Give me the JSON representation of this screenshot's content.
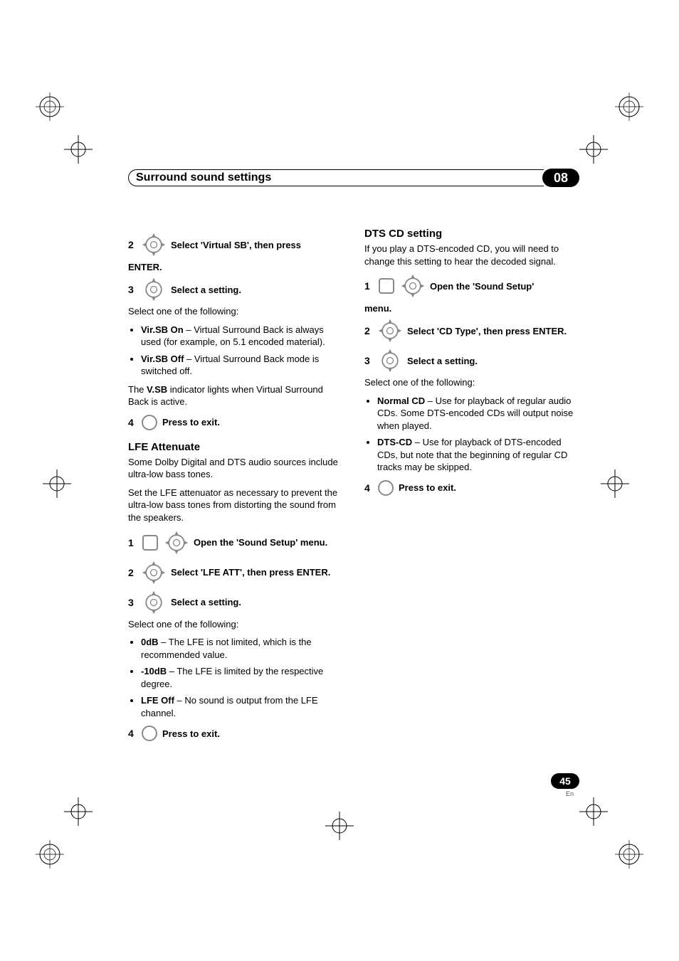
{
  "header": {
    "title": "Surround sound settings",
    "chapter": "08"
  },
  "left": {
    "vsb": {
      "step2": {
        "num": "2",
        "text": "Select 'Virtual SB', then press",
        "tail": "ENTER."
      },
      "step3": {
        "num": "3",
        "text": "Select a setting."
      },
      "select_one": "Select one of the following:",
      "opt1": {
        "k": "Vir.SB On",
        "v": " – Virtual Surround Back is always used (for example, on 5.1 encoded material)."
      },
      "opt2": {
        "k": "Vir.SB Off",
        "v": " – Virtual Surround Back mode is switched off."
      },
      "indicator_a": "The ",
      "indicator_b": "V.SB",
      "indicator_c": " indicator lights when Virtual Surround Back is active.",
      "step4": {
        "num": "4",
        "text": "Press to exit."
      }
    },
    "lfe": {
      "heading": "LFE Attenuate",
      "p1": "Some Dolby Digital and DTS audio sources include ultra-low bass tones.",
      "p2": "Set the LFE attenuator as necessary to prevent the ultra-low bass tones from distorting the sound from the speakers.",
      "step1": {
        "num": "1",
        "text": "Open the 'Sound Setup' menu."
      },
      "step2": {
        "num": "2",
        "text": "Select 'LFE ATT', then press ENTER."
      },
      "step3": {
        "num": "3",
        "text": "Select a setting."
      },
      "select_one": "Select one of the following:",
      "opt1": {
        "k": "0dB",
        "v": " – The LFE is not limited, which is the recommended value."
      },
      "opt2": {
        "k": "-10dB",
        "v": " – The LFE is limited by the respective degree."
      },
      "opt3": {
        "k": "LFE Off",
        "v": " – No sound is output from the LFE channel."
      },
      "step4": {
        "num": "4",
        "text": "Press to exit."
      }
    }
  },
  "right": {
    "dts": {
      "heading": "DTS CD setting",
      "p1": "If you play a DTS-encoded CD, you will need to change this setting to hear the decoded signal.",
      "step1": {
        "num": "1",
        "text": "Open the 'Sound Setup'",
        "tail": "menu."
      },
      "step2": {
        "num": "2",
        "text": "Select 'CD Type', then press ENTER."
      },
      "step3": {
        "num": "3",
        "text": "Select a setting."
      },
      "select_one": "Select one of the following:",
      "opt1": {
        "k": "Normal CD",
        "v": " – Use for playback of regular audio CDs. Some DTS-encoded CDs will output noise when played."
      },
      "opt2": {
        "k": "DTS-CD",
        "v": " – Use for playback of DTS-encoded CDs, but note that the beginning of regular CD tracks may be skipped."
      },
      "step4": {
        "num": "4",
        "text": "Press to exit."
      }
    }
  },
  "footer": {
    "page": "45",
    "lang": "En"
  }
}
